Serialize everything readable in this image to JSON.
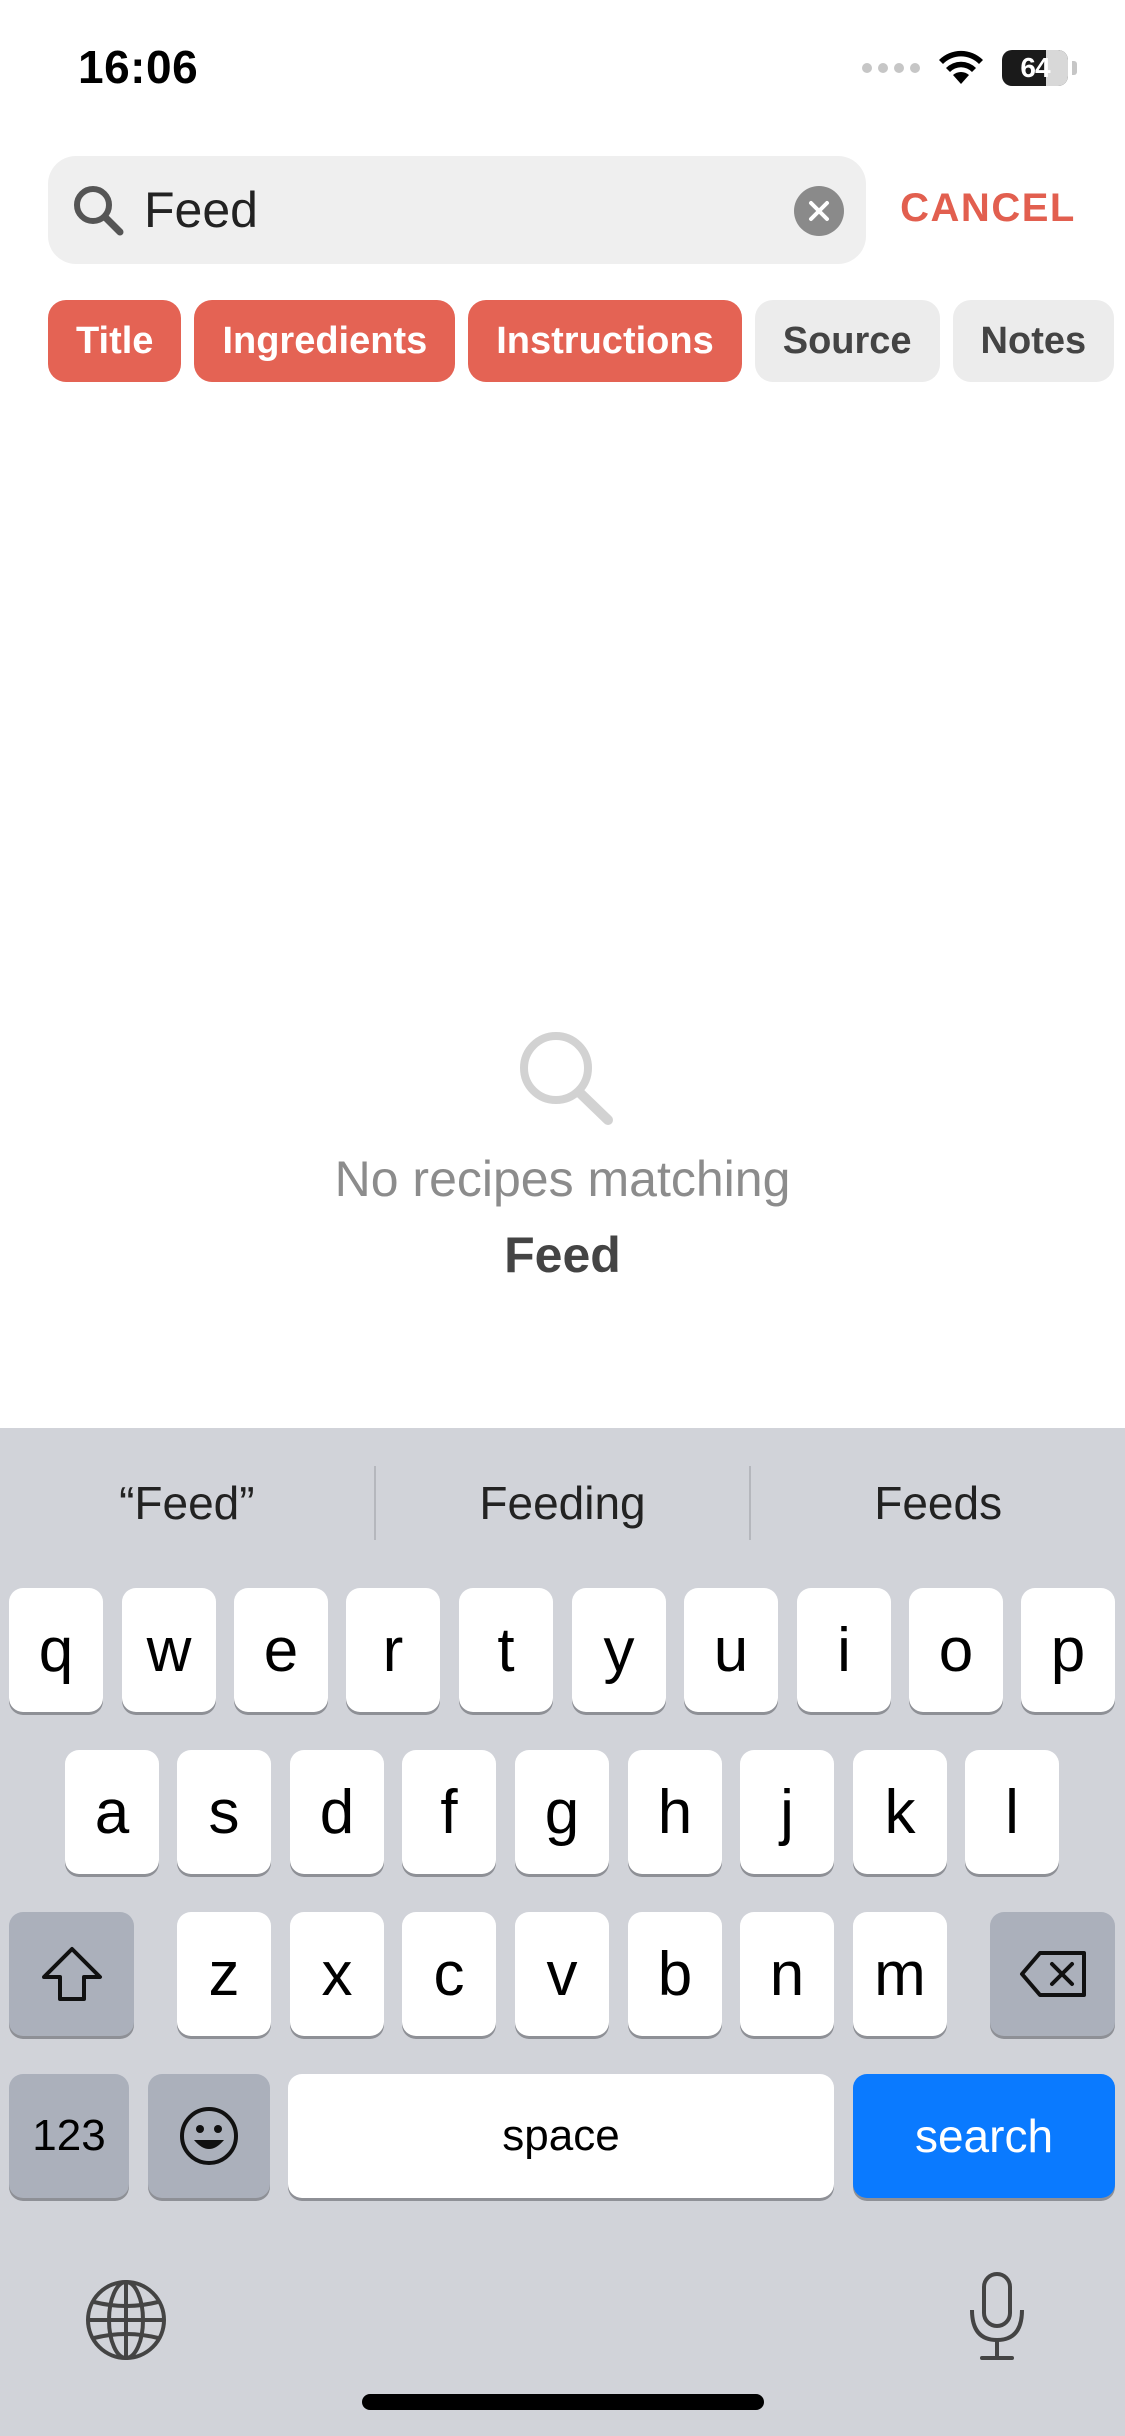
{
  "status_bar": {
    "time": "16:06",
    "battery_level": "64"
  },
  "search": {
    "query": "Feed",
    "placeholder": "",
    "cancel_label": "CANCEL"
  },
  "filters": [
    {
      "label": "Title",
      "active": true
    },
    {
      "label": "Ingredients",
      "active": true
    },
    {
      "label": "Instructions",
      "active": true
    },
    {
      "label": "Source",
      "active": false
    },
    {
      "label": "Notes",
      "active": false
    }
  ],
  "empty_state": {
    "message": "No recipes matching",
    "query": "Feed"
  },
  "keyboard": {
    "suggestions": [
      "“Feed”",
      "Feeding",
      "Feeds"
    ],
    "row1": [
      "q",
      "w",
      "e",
      "r",
      "t",
      "y",
      "u",
      "i",
      "o",
      "p"
    ],
    "row2": [
      "a",
      "s",
      "d",
      "f",
      "g",
      "h",
      "j",
      "k",
      "l"
    ],
    "row3": [
      "z",
      "x",
      "c",
      "v",
      "b",
      "n",
      "m"
    ],
    "numbers_label": "123",
    "space_label": "space",
    "search_label": "search"
  },
  "colors": {
    "accent": "#e46354",
    "cancel": "#e25f4f",
    "keyboard_blue": "#0a7aff"
  },
  "icons": [
    "search-icon",
    "clear-icon",
    "wifi-icon",
    "shift-icon",
    "backspace-icon",
    "emoji-icon",
    "globe-icon",
    "microphone-icon"
  ]
}
